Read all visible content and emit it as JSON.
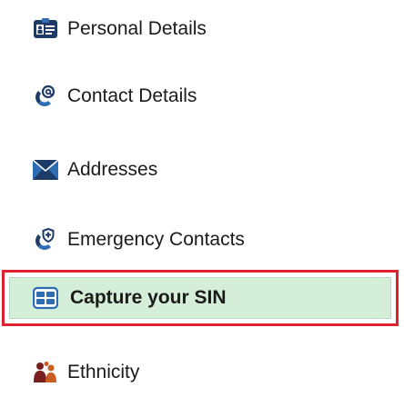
{
  "menu": {
    "items": [
      {
        "label": "Personal Details",
        "icon": "id-card-icon"
      },
      {
        "label": "Contact Details",
        "icon": "contact-phone-icon"
      },
      {
        "label": "Addresses",
        "icon": "envelope-icon"
      },
      {
        "label": "Emergency Contacts",
        "icon": "emergency-contact-icon"
      },
      {
        "label": "Capture your SIN",
        "icon": "sin-card-icon",
        "selected": true
      },
      {
        "label": "Ethnicity",
        "icon": "people-icon"
      }
    ]
  },
  "colors": {
    "icon_primary": "#1e3a66",
    "icon_secondary": "#2e6db4",
    "selected_background": "#d5eed9",
    "selected_border": "#e0202e",
    "ethnicity_primary": "#7a1f1f",
    "ethnicity_secondary": "#c95d22"
  }
}
